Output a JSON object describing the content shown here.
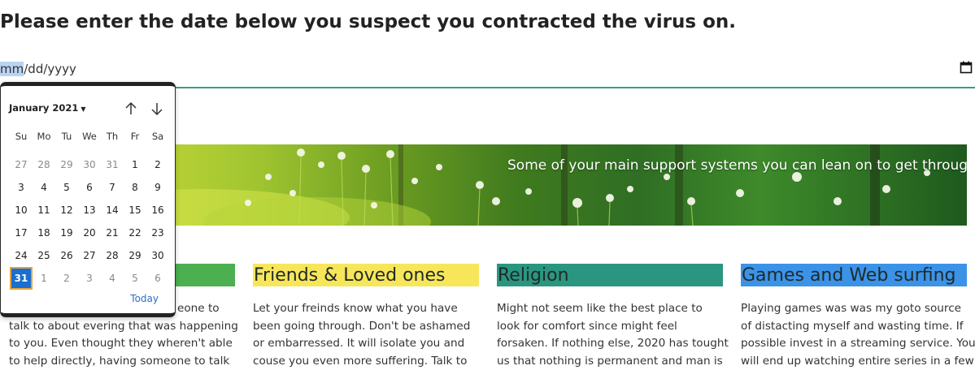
{
  "heading": "Please enter the date below you suspect you contracted the virus on.",
  "date_input": {
    "month": "mm",
    "sep1": "/",
    "day": "dd",
    "sep2": "/",
    "year": "yyyy",
    "icon": "calendar-icon"
  },
  "calendar": {
    "month_label": "January 2021",
    "up_icon": "arrow-up-icon",
    "down_icon": "arrow-down-icon",
    "weekdays": [
      "Su",
      "Mo",
      "Tu",
      "We",
      "Th",
      "Fr",
      "Sa"
    ],
    "days": [
      {
        "d": "27",
        "o": true
      },
      {
        "d": "28",
        "o": true
      },
      {
        "d": "29",
        "o": true
      },
      {
        "d": "30",
        "o": true
      },
      {
        "d": "31",
        "o": true
      },
      {
        "d": "1"
      },
      {
        "d": "2"
      },
      {
        "d": "3"
      },
      {
        "d": "4"
      },
      {
        "d": "5"
      },
      {
        "d": "6"
      },
      {
        "d": "7"
      },
      {
        "d": "8"
      },
      {
        "d": "9"
      },
      {
        "d": "10"
      },
      {
        "d": "11"
      },
      {
        "d": "12"
      },
      {
        "d": "13"
      },
      {
        "d": "14"
      },
      {
        "d": "15"
      },
      {
        "d": "16"
      },
      {
        "d": "17"
      },
      {
        "d": "18"
      },
      {
        "d": "19"
      },
      {
        "d": "20"
      },
      {
        "d": "21"
      },
      {
        "d": "22"
      },
      {
        "d": "23"
      },
      {
        "d": "24"
      },
      {
        "d": "25"
      },
      {
        "d": "26"
      },
      {
        "d": "27"
      },
      {
        "d": "28"
      },
      {
        "d": "29"
      },
      {
        "d": "30"
      },
      {
        "d": "31",
        "sel": true
      },
      {
        "d": "1",
        "o": true
      },
      {
        "d": "2",
        "o": true
      },
      {
        "d": "3",
        "o": true
      },
      {
        "d": "4",
        "o": true
      },
      {
        "d": "5",
        "o": true
      },
      {
        "d": "6",
        "o": true
      }
    ],
    "today_label": "Today"
  },
  "banner": {
    "text": "Some of your main support systems you can lean on to get through this"
  },
  "columns": [
    {
      "title": "",
      "color": "#4caf50",
      "lines": [
        "eone to",
        "talk to about evering that was happening",
        "to you. Even thought they wheren't able",
        "to help directly, having someone to talk"
      ]
    },
    {
      "title": "Friends & Loved ones",
      "color": "#f7e65a",
      "lines": [
        "Let your freinds know what you have",
        "been going through. Don't be ashamed",
        "or embarressed. It will isolate you and",
        "couse you even more suffering. Talk to"
      ]
    },
    {
      "title": "Religion",
      "color": "#2a9680",
      "lines": [
        "Might not seem like the best place to",
        "look for comfort since might feel",
        "forsaken. If nothing else, 2020 has tought",
        "us that nothing is permanent and man is"
      ]
    },
    {
      "title": "Games and Web surfing",
      "color": "#3b93e8",
      "lines": [
        "Playing games was was my goto source",
        "of distacting myself and wasting time. If",
        "possible invest in a streaming service. You",
        "will end up watching entire series in a few"
      ]
    }
  ]
}
